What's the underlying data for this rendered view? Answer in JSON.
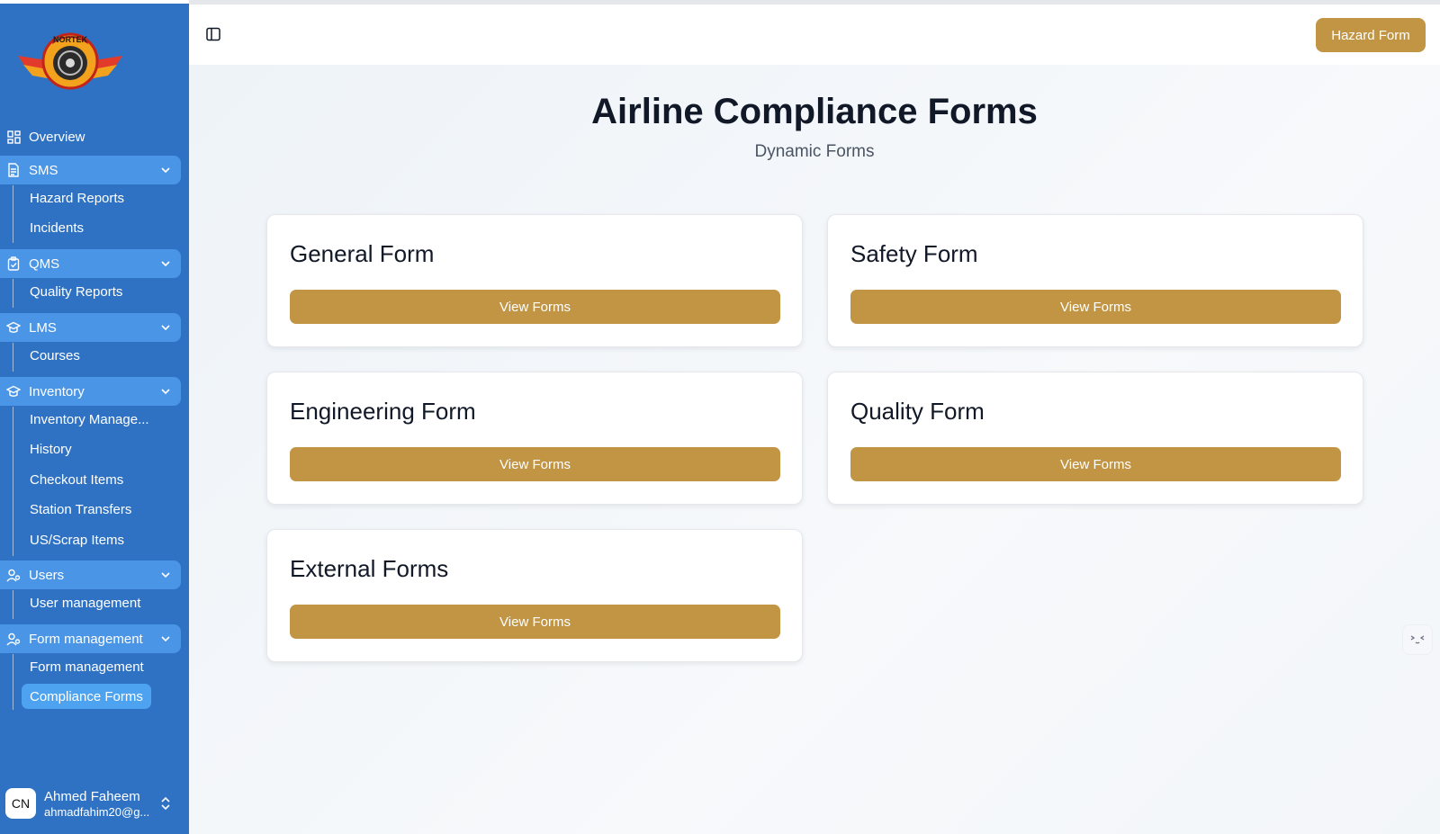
{
  "brand": {
    "logo_text": "NORTEK"
  },
  "sidebar": {
    "items": [
      {
        "label": "Overview",
        "icon": "grid-icon",
        "type": "link"
      },
      {
        "label": "SMS",
        "icon": "document-icon",
        "type": "group",
        "children": [
          "Hazard Reports",
          "Incidents"
        ]
      },
      {
        "label": "QMS",
        "icon": "clipboard-icon",
        "type": "group",
        "children": [
          "Quality Reports"
        ]
      },
      {
        "label": "LMS",
        "icon": "graduation-cap-icon",
        "type": "group",
        "children": [
          "Courses"
        ]
      },
      {
        "label": "Inventory",
        "icon": "graduation-cap-icon",
        "type": "group",
        "children": [
          "Inventory Manage...",
          "History",
          "Checkout Items",
          "Station Transfers",
          "US/Scrap Items"
        ]
      },
      {
        "label": "Users",
        "icon": "user-icon",
        "type": "group",
        "children": [
          "User management"
        ]
      },
      {
        "label": "Form management",
        "icon": "user-icon",
        "type": "group",
        "children": [
          "Form management",
          "Compliance Forms"
        ]
      }
    ],
    "active_item": "Compliance Forms"
  },
  "user": {
    "initials": "CN",
    "name": "Ahmed Faheem",
    "email": "ahmadfahim20@g..."
  },
  "header": {
    "hazard_button": "Hazard Form"
  },
  "main": {
    "title": "Airline Compliance Forms",
    "subtitle": "Dynamic Forms",
    "cards": [
      {
        "title": "General Form",
        "button": "View Forms"
      },
      {
        "title": "Safety Form",
        "button": "View Forms"
      },
      {
        "title": "Engineering Form",
        "button": "View Forms"
      },
      {
        "title": "Quality Form",
        "button": "View Forms"
      },
      {
        "title": "External Forms",
        "button": "View Forms"
      }
    ]
  },
  "colors": {
    "sidebar": "#2f72c4",
    "group_highlight": "#4a95e6",
    "active": "#4da3f0",
    "accent": "#c29545"
  }
}
